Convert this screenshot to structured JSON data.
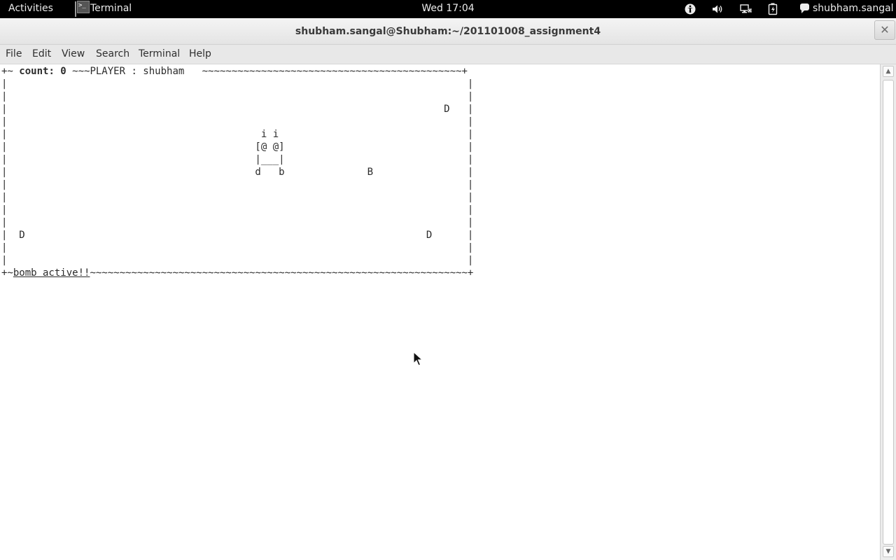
{
  "topbar": {
    "activities": "Activities",
    "app_name": "Terminal",
    "clock": "Wed 17:04",
    "user": "shubham.sangal",
    "tray_icons": [
      "accessibility-icon",
      "volume-icon",
      "network-icon",
      "battery-icon"
    ]
  },
  "window": {
    "title": "shubham.sangal@Shubham:~/201101008_assignment4",
    "close_glyph": "✕"
  },
  "menubar": {
    "file": "File",
    "edit": "Edit",
    "view": "View",
    "search": "Search",
    "terminal": "Terminal",
    "help": "Help"
  },
  "game": {
    "top_prefix": "+~ ",
    "count_text": "count: 0",
    "top_rest": " ~~~PLAYER : shubham   ~~~~~~~~~~~~~~~~~~~~~~~~~~~~~~~~~~~~~~~~~~~~+",
    "rows": [
      "|                                                                              |",
      "|                                                                              |",
      "|                                                                          D   |",
      "|                                                                              |",
      "|                                           i i                                |",
      "|                                          [@ @]                               |",
      "|                                          |___|                               |",
      "|                                          d   b              B                |",
      "|                                                                              |",
      "|                                                                              |",
      "|                                                                              |",
      "|                                                                              |",
      "|  D                                                                    D      |",
      "|                                                                              |",
      "|                                                                              |"
    ],
    "bottom_prefix": "+~",
    "bomb_text": "bomb active!!",
    "bottom_rest": "~~~~~~~~~~~~~~~~~~~~~~~~~~~~~~~~~~~~~~~~~~~~~~~~~~~~~~~~~~~~~~~~+"
  },
  "scrollbar": {
    "up_glyph": "▲",
    "down_glyph": "▼"
  }
}
